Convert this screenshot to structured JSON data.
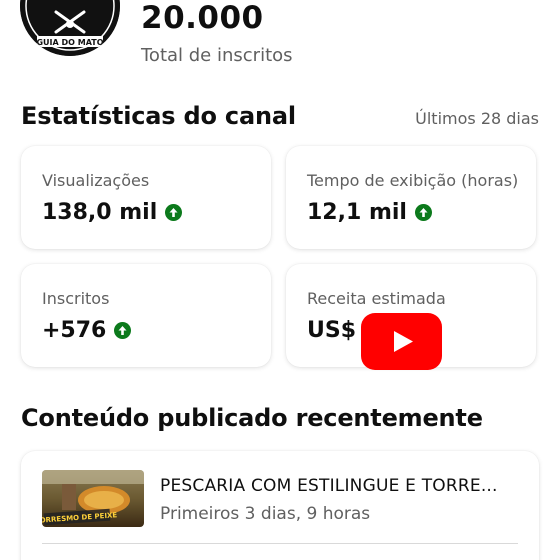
{
  "channel": {
    "avatar_text": "GUIA DO MATO",
    "subscriber_count": "20.000",
    "subscriber_label": "Total de inscritos"
  },
  "stats_section": {
    "title": "Estatísticas do canal",
    "period": "Últimos 28 dias",
    "cards": [
      {
        "label": "Visualizações",
        "value": "138,0 mil",
        "trend": "up"
      },
      {
        "label": "Tempo de exibição (horas)",
        "value": "12,1 mil",
        "trend": "up"
      },
      {
        "label": "Inscritos",
        "value": "+576",
        "trend": "up"
      },
      {
        "label": "Receita estimada",
        "value": "US$"
      }
    ]
  },
  "recent_section": {
    "title": "Conteúdo publicado recentemente",
    "videos": [
      {
        "title": "PESCARIA COM ESTILINGUE E TORRE...",
        "meta": "Primeiros 3 dias, 9 horas",
        "thumbnail_caption": "TORRESMO DE PEIXE"
      }
    ]
  },
  "overlay": {
    "icon": "youtube-play-icon"
  },
  "colors": {
    "trend_up": "#0c7a1c",
    "youtube_red": "#ff0000",
    "secondary_text": "#606060",
    "primary_text": "#0f0f0f"
  }
}
